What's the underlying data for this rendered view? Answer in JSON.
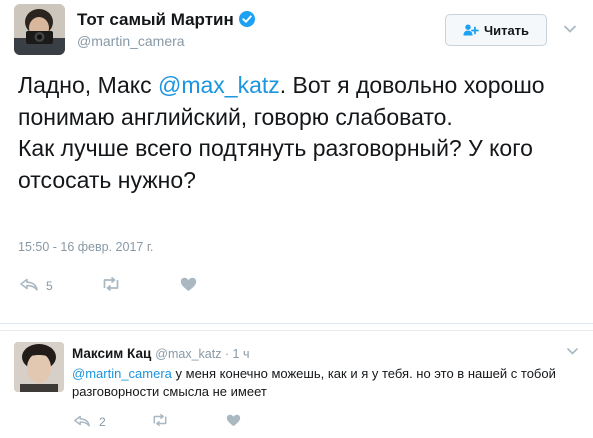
{
  "tweet": {
    "author_name": "Тот самый Мартин",
    "author_handle": "@martin_camera",
    "follow_label": "Читать",
    "text_before_mention": "Ладно, Макс ",
    "mention": "@max_katz",
    "text_after_mention": ". Вот я довольно хорошо понимаю английский, говорю слабовато.",
    "text_line2": "Как лучше всего подтянуть разговорный? У кого отсосать нужно?",
    "timestamp": "15:50 - 16 февр. 2017 г.",
    "reply_count": "5",
    "icons": [
      "reply-icon",
      "retweet-icon",
      "like-icon",
      "verified-badge-icon",
      "follow-person-icon",
      "chevron-down-icon"
    ]
  },
  "reply": {
    "author_name": "Максим Кац",
    "author_handle": "@max_katz · 1 ч",
    "mention": "@martin_camera",
    "text": " у меня конечно можешь, как и я у тебя. но это в нашей с тобой разговорности смысла не имеет",
    "reply_count": "2"
  },
  "colors": {
    "link": "#1b95e0",
    "verified": "#1da1f2",
    "muted": "#8899a6",
    "text": "#14171a",
    "divider": "#e1e8ed"
  }
}
